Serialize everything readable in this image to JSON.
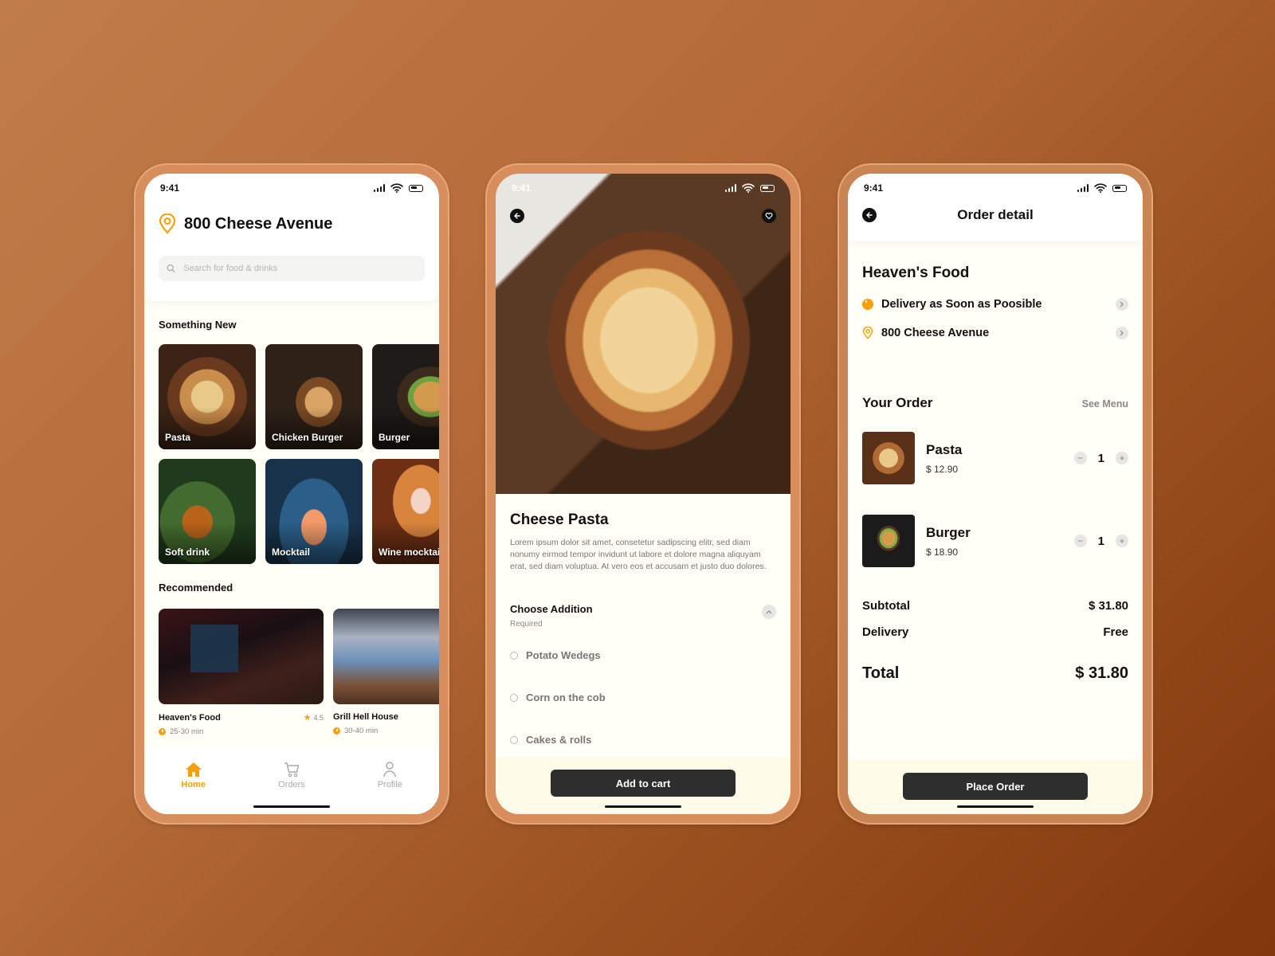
{
  "status_time": "9:41",
  "colors": {
    "accent": "#f5a00b",
    "button_dark": "#2e2e2e",
    "screen_bg": "#fffef7"
  },
  "home": {
    "location": "800 Cheese Avenue",
    "search_placeholder": "Search for food & drinks",
    "something_new_title": "Something New",
    "categories": [
      {
        "label": "Pasta"
      },
      {
        "label": "Chicken Burger"
      },
      {
        "label": "Burger"
      },
      {
        "label": "Soft drink"
      },
      {
        "label": "Mocktail"
      },
      {
        "label": "Wine mocktail"
      }
    ],
    "recommended_title": "Recommended",
    "restaurants": [
      {
        "name": "Heaven's Food",
        "rating": "4.5",
        "duration": "25-30 min"
      },
      {
        "name": "Grill Hell House",
        "duration": "30-40 min"
      }
    ],
    "tabs": [
      {
        "label": "Home",
        "icon": "home-icon",
        "active": true
      },
      {
        "label": "Orders",
        "icon": "cart-icon"
      },
      {
        "label": "Profile",
        "icon": "user-icon"
      }
    ]
  },
  "product": {
    "title": "Cheese Pasta",
    "description": "Lorem ipsum dolor sit amet, consetetur sadipscing elitr, sed diam nonumy eirmod tempor invidunt ut labore et dolore magna aliquyam erat, sed diam voluptua. At vero eos et accusam et justo duo dolores.",
    "addition_title": "Choose Addition",
    "addition_subtitle": "Required",
    "options": [
      {
        "label": "Potato Wedegs"
      },
      {
        "label": "Corn on the cob"
      },
      {
        "label": "Cakes & rolls"
      }
    ],
    "cta": "Add to cart"
  },
  "order": {
    "title": "Order detail",
    "restaurant": "Heaven's Food",
    "delivery": "Delivery as Soon as Poosible",
    "address": "800 Cheese Avenue",
    "your_order": "Your Order",
    "see_menu": "See Menu",
    "items": [
      {
        "name": "Pasta",
        "price": "$ 12.90",
        "qty": "1"
      },
      {
        "name": "Burger",
        "price": "$ 18.90",
        "qty": "1"
      }
    ],
    "subtotal_label": "Subtotal",
    "subtotal": "$ 31.80",
    "delivery_label": "Delivery",
    "delivery_fee": "Free",
    "total_label": "Total",
    "total": "$ 31.80",
    "cta": "Place Order"
  }
}
